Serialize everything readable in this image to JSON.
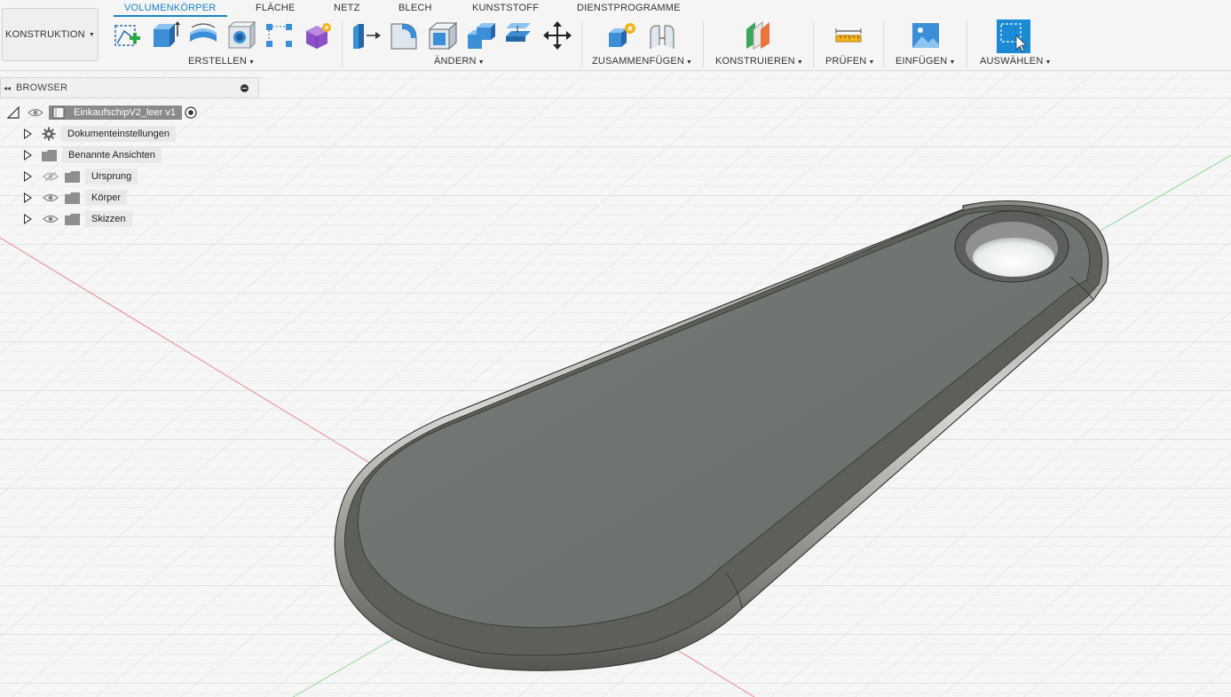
{
  "workspace": {
    "label": "KONSTRUKTION"
  },
  "tabs": [
    {
      "label": "VOLUMENKÖRPER",
      "active": true
    },
    {
      "label": "FLÄCHE"
    },
    {
      "label": "NETZ"
    },
    {
      "label": "BLECH"
    },
    {
      "label": "KUNSTSTOFF"
    },
    {
      "label": "DIENSTPROGRAMME"
    }
  ],
  "groups": {
    "erstellen": "ERSTELLEN",
    "aendern": "ÄNDERN",
    "zusammenfuegen": "ZUSAMMENFÜGEN",
    "konstruieren": "KONSTRUIEREN",
    "pruefen": "PRÜFEN",
    "einfuegen": "EINFÜGEN",
    "auswaehlen": "AUSWÄHLEN"
  },
  "browser": {
    "title": "BROWSER",
    "root": "EinkaufschipV2_leer v1",
    "items": [
      {
        "label": "Dokumenteinstellungen",
        "icon": "gear-icon"
      },
      {
        "label": "Benannte Ansichten",
        "icon": "folder-icon"
      },
      {
        "label": "Ursprung",
        "icon": "folder-icon",
        "hidden": true
      },
      {
        "label": "Körper",
        "icon": "folder-icon"
      },
      {
        "label": "Skizzen",
        "icon": "folder-icon"
      }
    ]
  },
  "colors": {
    "accent": "#1a83c9",
    "model_top": "#6f736f",
    "model_rim": "#5c5d59",
    "x_axis": "#e58a8a",
    "y_axis": "#8fd98f"
  }
}
